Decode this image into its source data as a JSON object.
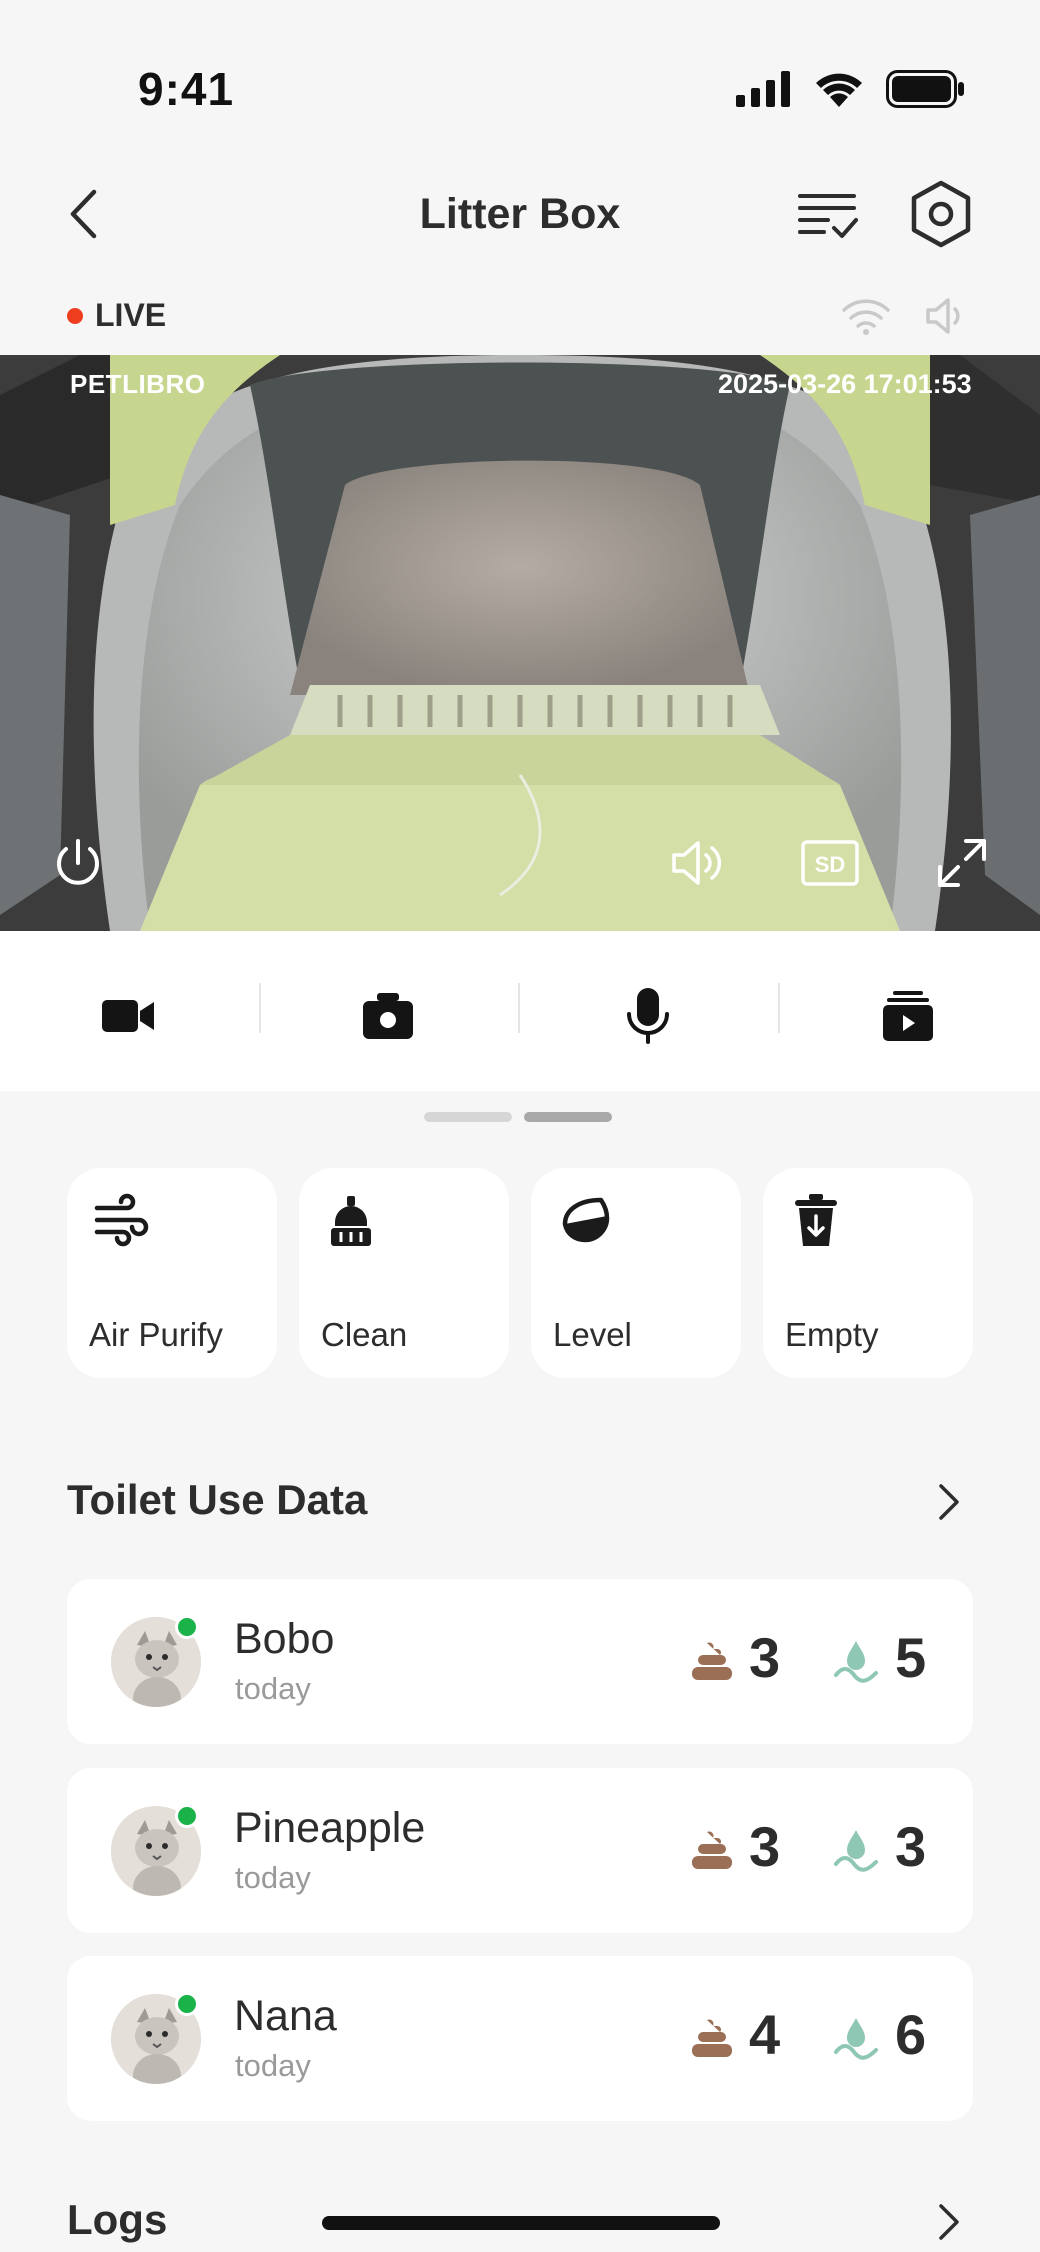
{
  "status_bar": {
    "time": "9:41"
  },
  "nav": {
    "title": "Litter Box"
  },
  "live": {
    "label": "LIVE"
  },
  "video": {
    "brand": "PETLIBRO",
    "timestamp": "2025-03-26 17:01:53"
  },
  "quick_actions": [
    {
      "label": "Air Purify",
      "icon": "air-purify-icon"
    },
    {
      "label": "Clean",
      "icon": "clean-icon"
    },
    {
      "label": "Level",
      "icon": "level-icon"
    },
    {
      "label": "Empty",
      "icon": "empty-icon"
    }
  ],
  "toilet_use": {
    "title": "Toilet Use Data",
    "pets": [
      {
        "name": "Bobo",
        "when": "today",
        "poop": "3",
        "pee": "5"
      },
      {
        "name": "Pineapple",
        "when": "today",
        "poop": "3",
        "pee": "3"
      },
      {
        "name": "Nana",
        "when": "today",
        "poop": "4",
        "pee": "6"
      }
    ]
  },
  "logs": {
    "title": "Logs"
  },
  "colors": {
    "live_dot": "#ee3d1f",
    "online": "#19b34a",
    "poop": "#9b6f55",
    "pee": "#8fc7b5",
    "video_bg": "#3a3b3a"
  }
}
